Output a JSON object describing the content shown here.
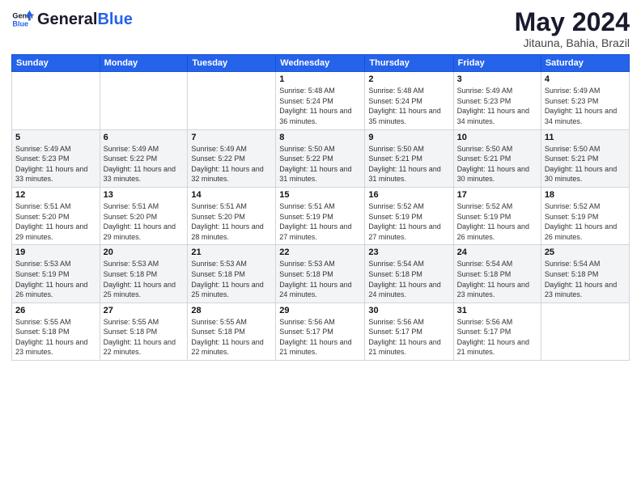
{
  "header": {
    "logo_general": "General",
    "logo_blue": "Blue",
    "month_title": "May 2024",
    "location": "Jitauna, Bahia, Brazil"
  },
  "weekdays": [
    "Sunday",
    "Monday",
    "Tuesday",
    "Wednesday",
    "Thursday",
    "Friday",
    "Saturday"
  ],
  "weeks": [
    [
      {
        "day": "",
        "sunrise": "",
        "sunset": "",
        "daylight": "",
        "empty": true
      },
      {
        "day": "",
        "sunrise": "",
        "sunset": "",
        "daylight": "",
        "empty": true
      },
      {
        "day": "",
        "sunrise": "",
        "sunset": "",
        "daylight": "",
        "empty": true
      },
      {
        "day": "1",
        "sunrise": "Sunrise: 5:48 AM",
        "sunset": "Sunset: 5:24 PM",
        "daylight": "Daylight: 11 hours and 36 minutes.",
        "empty": false
      },
      {
        "day": "2",
        "sunrise": "Sunrise: 5:48 AM",
        "sunset": "Sunset: 5:24 PM",
        "daylight": "Daylight: 11 hours and 35 minutes.",
        "empty": false
      },
      {
        "day": "3",
        "sunrise": "Sunrise: 5:49 AM",
        "sunset": "Sunset: 5:23 PM",
        "daylight": "Daylight: 11 hours and 34 minutes.",
        "empty": false
      },
      {
        "day": "4",
        "sunrise": "Sunrise: 5:49 AM",
        "sunset": "Sunset: 5:23 PM",
        "daylight": "Daylight: 11 hours and 34 minutes.",
        "empty": false
      }
    ],
    [
      {
        "day": "5",
        "sunrise": "Sunrise: 5:49 AM",
        "sunset": "Sunset: 5:23 PM",
        "daylight": "Daylight: 11 hours and 33 minutes.",
        "empty": false
      },
      {
        "day": "6",
        "sunrise": "Sunrise: 5:49 AM",
        "sunset": "Sunset: 5:22 PM",
        "daylight": "Daylight: 11 hours and 33 minutes.",
        "empty": false
      },
      {
        "day": "7",
        "sunrise": "Sunrise: 5:49 AM",
        "sunset": "Sunset: 5:22 PM",
        "daylight": "Daylight: 11 hours and 32 minutes.",
        "empty": false
      },
      {
        "day": "8",
        "sunrise": "Sunrise: 5:50 AM",
        "sunset": "Sunset: 5:22 PM",
        "daylight": "Daylight: 11 hours and 31 minutes.",
        "empty": false
      },
      {
        "day": "9",
        "sunrise": "Sunrise: 5:50 AM",
        "sunset": "Sunset: 5:21 PM",
        "daylight": "Daylight: 11 hours and 31 minutes.",
        "empty": false
      },
      {
        "day": "10",
        "sunrise": "Sunrise: 5:50 AM",
        "sunset": "Sunset: 5:21 PM",
        "daylight": "Daylight: 11 hours and 30 minutes.",
        "empty": false
      },
      {
        "day": "11",
        "sunrise": "Sunrise: 5:50 AM",
        "sunset": "Sunset: 5:21 PM",
        "daylight": "Daylight: 11 hours and 30 minutes.",
        "empty": false
      }
    ],
    [
      {
        "day": "12",
        "sunrise": "Sunrise: 5:51 AM",
        "sunset": "Sunset: 5:20 PM",
        "daylight": "Daylight: 11 hours and 29 minutes.",
        "empty": false
      },
      {
        "day": "13",
        "sunrise": "Sunrise: 5:51 AM",
        "sunset": "Sunset: 5:20 PM",
        "daylight": "Daylight: 11 hours and 29 minutes.",
        "empty": false
      },
      {
        "day": "14",
        "sunrise": "Sunrise: 5:51 AM",
        "sunset": "Sunset: 5:20 PM",
        "daylight": "Daylight: 11 hours and 28 minutes.",
        "empty": false
      },
      {
        "day": "15",
        "sunrise": "Sunrise: 5:51 AM",
        "sunset": "Sunset: 5:19 PM",
        "daylight": "Daylight: 11 hours and 27 minutes.",
        "empty": false
      },
      {
        "day": "16",
        "sunrise": "Sunrise: 5:52 AM",
        "sunset": "Sunset: 5:19 PM",
        "daylight": "Daylight: 11 hours and 27 minutes.",
        "empty": false
      },
      {
        "day": "17",
        "sunrise": "Sunrise: 5:52 AM",
        "sunset": "Sunset: 5:19 PM",
        "daylight": "Daylight: 11 hours and 26 minutes.",
        "empty": false
      },
      {
        "day": "18",
        "sunrise": "Sunrise: 5:52 AM",
        "sunset": "Sunset: 5:19 PM",
        "daylight": "Daylight: 11 hours and 26 minutes.",
        "empty": false
      }
    ],
    [
      {
        "day": "19",
        "sunrise": "Sunrise: 5:53 AM",
        "sunset": "Sunset: 5:19 PM",
        "daylight": "Daylight: 11 hours and 26 minutes.",
        "empty": false
      },
      {
        "day": "20",
        "sunrise": "Sunrise: 5:53 AM",
        "sunset": "Sunset: 5:18 PM",
        "daylight": "Daylight: 11 hours and 25 minutes.",
        "empty": false
      },
      {
        "day": "21",
        "sunrise": "Sunrise: 5:53 AM",
        "sunset": "Sunset: 5:18 PM",
        "daylight": "Daylight: 11 hours and 25 minutes.",
        "empty": false
      },
      {
        "day": "22",
        "sunrise": "Sunrise: 5:53 AM",
        "sunset": "Sunset: 5:18 PM",
        "daylight": "Daylight: 11 hours and 24 minutes.",
        "empty": false
      },
      {
        "day": "23",
        "sunrise": "Sunrise: 5:54 AM",
        "sunset": "Sunset: 5:18 PM",
        "daylight": "Daylight: 11 hours and 24 minutes.",
        "empty": false
      },
      {
        "day": "24",
        "sunrise": "Sunrise: 5:54 AM",
        "sunset": "Sunset: 5:18 PM",
        "daylight": "Daylight: 11 hours and 23 minutes.",
        "empty": false
      },
      {
        "day": "25",
        "sunrise": "Sunrise: 5:54 AM",
        "sunset": "Sunset: 5:18 PM",
        "daylight": "Daylight: 11 hours and 23 minutes.",
        "empty": false
      }
    ],
    [
      {
        "day": "26",
        "sunrise": "Sunrise: 5:55 AM",
        "sunset": "Sunset: 5:18 PM",
        "daylight": "Daylight: 11 hours and 23 minutes.",
        "empty": false
      },
      {
        "day": "27",
        "sunrise": "Sunrise: 5:55 AM",
        "sunset": "Sunset: 5:18 PM",
        "daylight": "Daylight: 11 hours and 22 minutes.",
        "empty": false
      },
      {
        "day": "28",
        "sunrise": "Sunrise: 5:55 AM",
        "sunset": "Sunset: 5:18 PM",
        "daylight": "Daylight: 11 hours and 22 minutes.",
        "empty": false
      },
      {
        "day": "29",
        "sunrise": "Sunrise: 5:56 AM",
        "sunset": "Sunset: 5:17 PM",
        "daylight": "Daylight: 11 hours and 21 minutes.",
        "empty": false
      },
      {
        "day": "30",
        "sunrise": "Sunrise: 5:56 AM",
        "sunset": "Sunset: 5:17 PM",
        "daylight": "Daylight: 11 hours and 21 minutes.",
        "empty": false
      },
      {
        "day": "31",
        "sunrise": "Sunrise: 5:56 AM",
        "sunset": "Sunset: 5:17 PM",
        "daylight": "Daylight: 11 hours and 21 minutes.",
        "empty": false
      },
      {
        "day": "",
        "sunrise": "",
        "sunset": "",
        "daylight": "",
        "empty": true
      }
    ]
  ]
}
